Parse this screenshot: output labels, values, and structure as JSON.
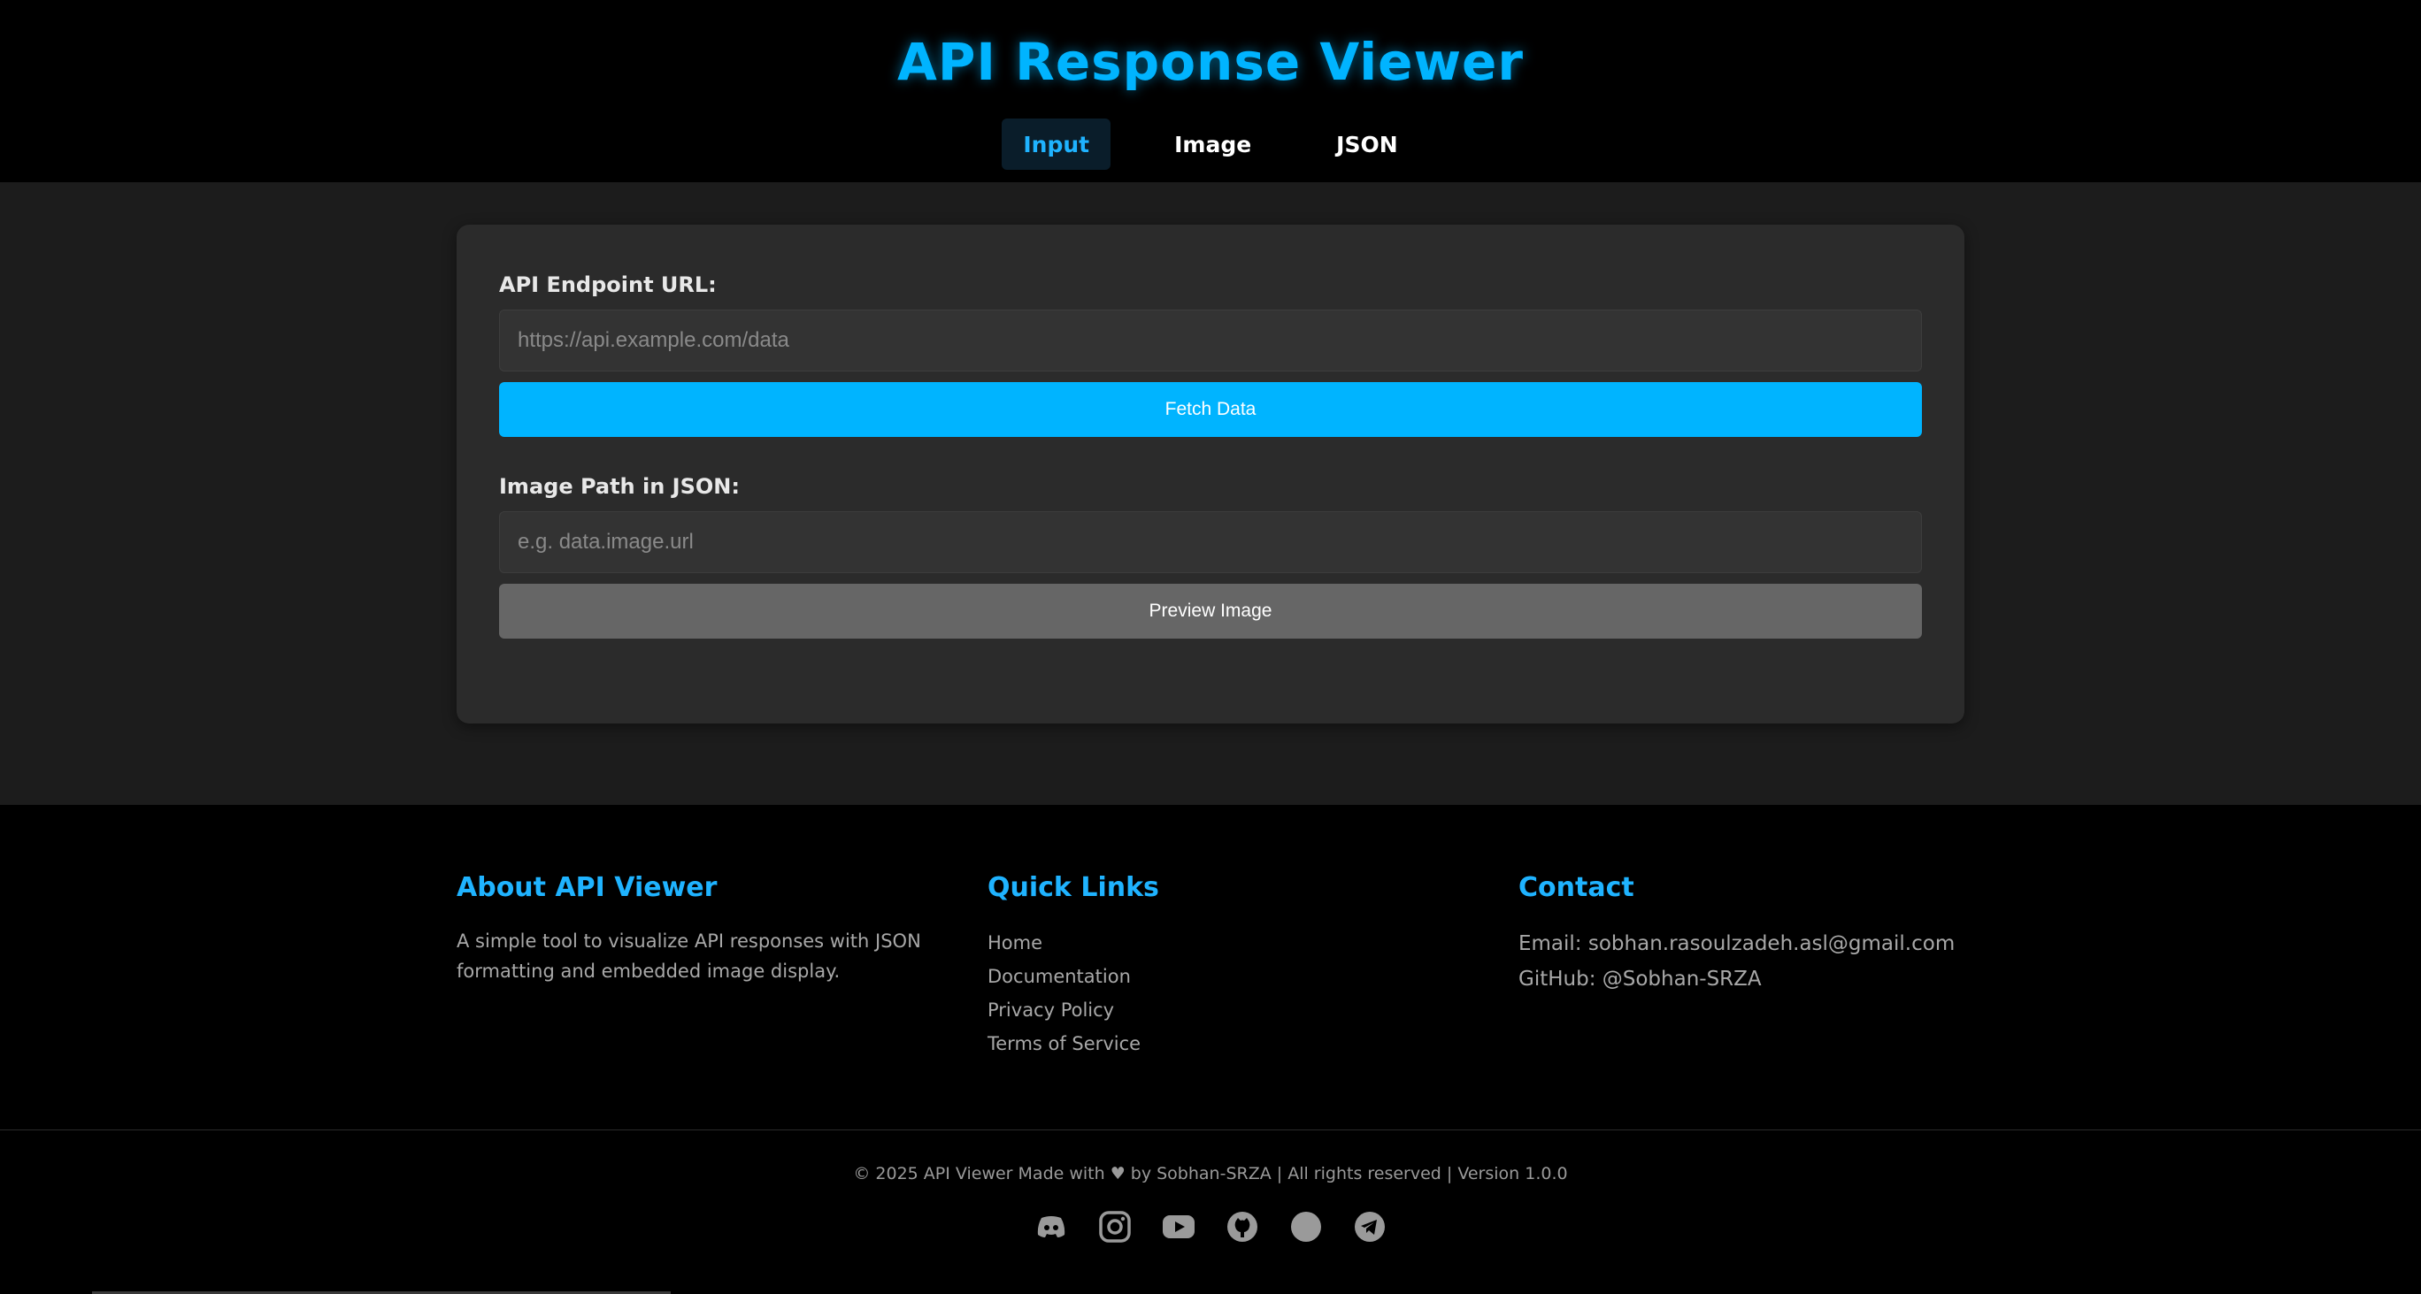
{
  "header": {
    "title": "API Response Viewer",
    "tabs": [
      {
        "label": "Input",
        "active": true
      },
      {
        "label": "Image",
        "active": false
      },
      {
        "label": "JSON",
        "active": false
      }
    ]
  },
  "form": {
    "endpoint_label": "API Endpoint URL:",
    "endpoint_placeholder": "https://api.example.com/data",
    "endpoint_value": "",
    "fetch_button": "Fetch Data",
    "image_path_label": "Image Path in JSON:",
    "image_path_placeholder": "e.g. data.image.url",
    "image_path_value": "",
    "preview_button": "Preview Image"
  },
  "footer": {
    "about": {
      "heading": "About API Viewer",
      "text": "A simple tool to visualize API responses with JSON formatting and embedded image display."
    },
    "quick_links": {
      "heading": "Quick Links",
      "links": [
        "Home",
        "Documentation",
        "Privacy Policy",
        "Terms of Service"
      ]
    },
    "contact": {
      "heading": "Contact",
      "email": "Email: sobhan.rasoulzadeh.asl@gmail.com",
      "github": "GitHub: @Sobhan-SRZA"
    },
    "copyright": "© 2025 API Viewer Made with ♥ by Sobhan-SRZA | All rights reserved | Version 1.0.0",
    "social_icons": [
      "discord-icon",
      "instagram-icon",
      "youtube-icon",
      "github-icon",
      "generic-circle-icon",
      "telegram-icon"
    ]
  },
  "colors": {
    "accent": "#00b4ff",
    "page_bg": "#000000",
    "main_bg": "#1c1c1c",
    "card_bg": "#2b2b2b",
    "secondary_button": "#666666"
  }
}
